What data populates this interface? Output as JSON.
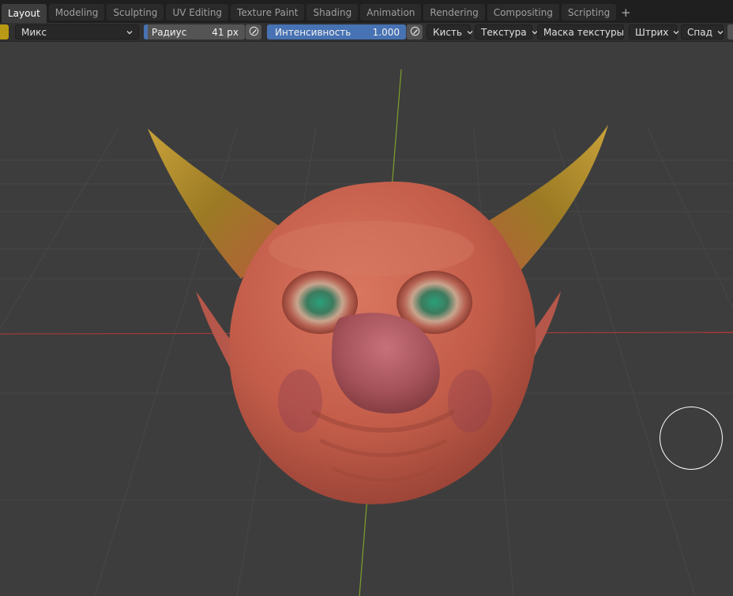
{
  "workspace_tabs": [
    {
      "label": "Layout",
      "active": true
    },
    {
      "label": "Modeling",
      "active": false
    },
    {
      "label": "Sculpting",
      "active": false
    },
    {
      "label": "UV Editing",
      "active": false
    },
    {
      "label": "Texture Paint",
      "active": false
    },
    {
      "label": "Shading",
      "active": false
    },
    {
      "label": "Animation",
      "active": false
    },
    {
      "label": "Rendering",
      "active": false
    },
    {
      "label": "Compositing",
      "active": false
    },
    {
      "label": "Scripting",
      "active": false
    }
  ],
  "add_tab_label": "+",
  "tool_settings": {
    "brush_color": "#b99a15",
    "blend_mode": "Микс",
    "radius": {
      "label": "Радиус",
      "value": "41 px"
    },
    "strength": {
      "label": "Интенсивность",
      "value": "1.000"
    },
    "menus": {
      "brush": "Кисть",
      "texture": "Текстура",
      "texture_mask": "Маска текстуры",
      "stroke": "Штрих",
      "falloff": "Спад"
    }
  },
  "icons": {
    "pen_pressure": "pen-pressure-icon",
    "chevron": "chevron-down-icon"
  },
  "viewport": {
    "object": "sculpted demon head",
    "skin_color": "#c6624f",
    "horn_color": "#a58a2c",
    "eye_color": "#2f7f5a"
  }
}
